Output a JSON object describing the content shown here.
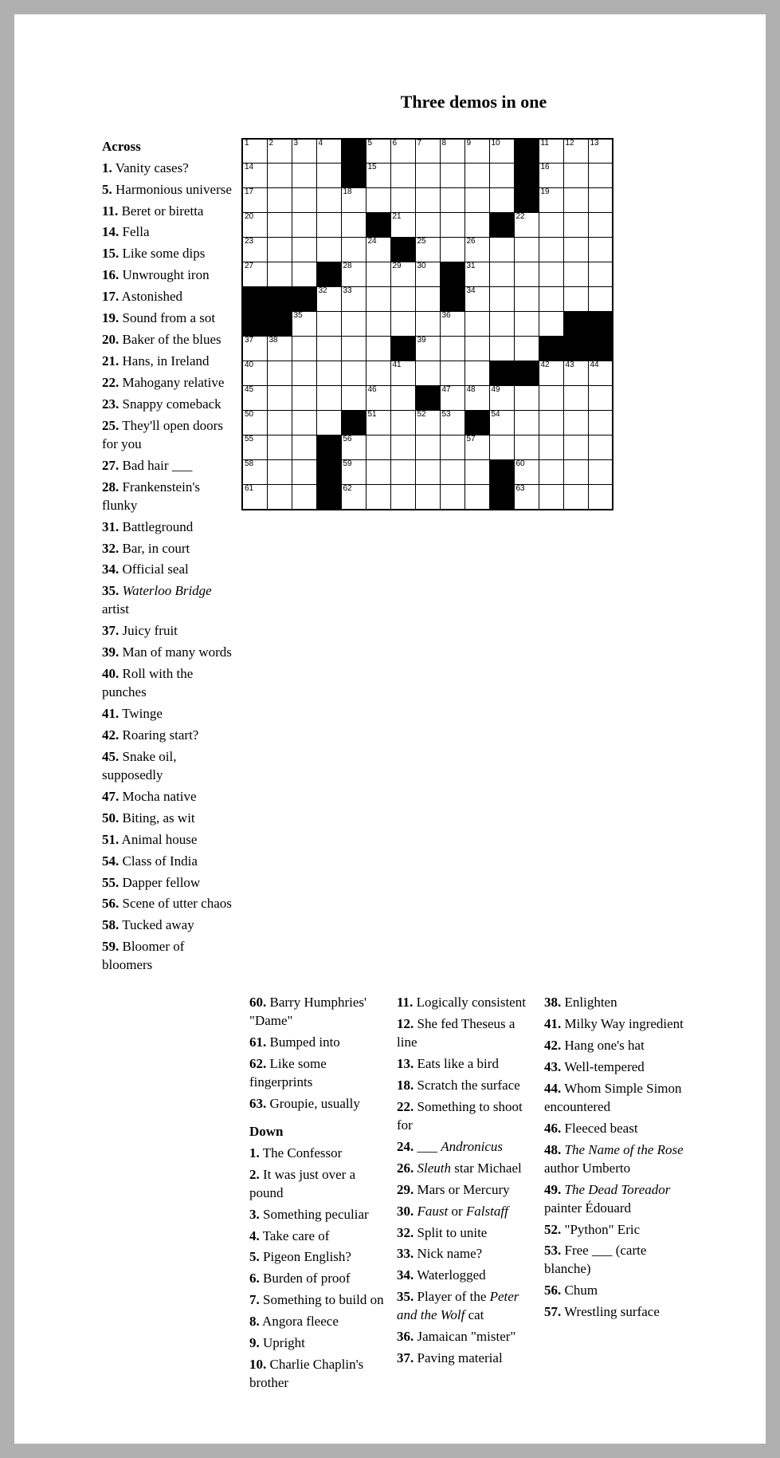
{
  "title": "Three demos in one",
  "grid": {
    "rows": 15,
    "cols": 15,
    "cells": [
      [
        {
          "n": 1
        },
        {
          "n": 2
        },
        {
          "n": 3
        },
        {
          "n": 4
        },
        {
          "b": 1
        },
        {
          "n": 5
        },
        {
          "n": 6
        },
        {
          "n": 7
        },
        {
          "n": 8
        },
        {
          "n": 9
        },
        {
          "n": 10
        },
        {
          "b": 1
        },
        {
          "n": 11
        },
        {
          "n": 12
        },
        {
          "n": 13
        }
      ],
      [
        {
          "n": 14
        },
        {},
        {},
        {},
        {
          "b": 1
        },
        {
          "n": 15
        },
        {},
        {},
        {},
        {},
        {},
        {
          "b": 1
        },
        {
          "n": 16
        },
        {},
        {}
      ],
      [
        {
          "n": 17
        },
        {},
        {},
        {},
        {
          "n": 18
        },
        {},
        {},
        {},
        {},
        {},
        {},
        {
          "b": 1
        },
        {
          "n": 19
        },
        {},
        {}
      ],
      [
        {
          "n": 20
        },
        {},
        {},
        {},
        {},
        {
          "b": 1
        },
        {
          "n": 21
        },
        {},
        {},
        {},
        {
          "b": 1
        },
        {
          "n": 22
        },
        {},
        {},
        {}
      ],
      [
        {
          "n": 23
        },
        {},
        {},
        {},
        {},
        {
          "n": 24
        },
        {
          "b": 1
        },
        {
          "n": 25
        },
        {},
        {
          "n": 26
        },
        {},
        {},
        {},
        {},
        {}
      ],
      [
        {
          "n": 27
        },
        {},
        {},
        {
          "b": 1
        },
        {
          "n": 28
        },
        {},
        {
          "n": 29
        },
        {
          "n": 30
        },
        {
          "b": 1
        },
        {
          "n": 31
        },
        {},
        {},
        {},
        {},
        {}
      ],
      [
        {
          "b": 1
        },
        {
          "b": 1
        },
        {
          "b": 1
        },
        {
          "n": 32
        },
        {
          "n": 33
        },
        {},
        {},
        {},
        {
          "b": 1
        },
        {
          "n": 34
        },
        {},
        {},
        {},
        {},
        {}
      ],
      [
        {
          "b": 1
        },
        {
          "b": 1
        },
        {
          "n": 35
        },
        {},
        {},
        {},
        {},
        {},
        {
          "n": 36
        },
        {},
        {},
        {},
        {},
        {
          "b": 1
        },
        {
          "b": 1
        }
      ],
      [
        {
          "n": 37
        },
        {
          "n": 38
        },
        {},
        {},
        {},
        {},
        {
          "b": 1
        },
        {
          "n": 39
        },
        {},
        {},
        {},
        {},
        {
          "b": 1
        },
        {
          "b": 1
        },
        {
          "b": 1
        }
      ],
      [
        {
          "n": 40
        },
        {},
        {},
        {},
        {},
        {},
        {
          "n": 41
        },
        {},
        {},
        {},
        {
          "b": 1
        },
        {
          "b": 1
        },
        {
          "n": 42
        },
        {
          "n": 43
        },
        {
          "n": 44
        }
      ],
      [
        {
          "n": 45
        },
        {},
        {},
        {},
        {},
        {
          "n": 46
        },
        {},
        {
          "b": 1
        },
        {
          "n": 47
        },
        {
          "n": 48
        },
        {
          "n": 49
        },
        {},
        {},
        {},
        {}
      ],
      [
        {
          "n": 50
        },
        {},
        {},
        {},
        {
          "b": 1
        },
        {
          "n": 51
        },
        {},
        {
          "n": 52
        },
        {
          "n": 53
        },
        {
          "b": 1
        },
        {
          "n": 54
        },
        {},
        {},
        {},
        {}
      ],
      [
        {
          "n": 55
        },
        {},
        {},
        {
          "b": 1
        },
        {
          "n": 56
        },
        {},
        {},
        {},
        {},
        {
          "n": 57
        },
        {},
        {},
        {},
        {},
        {}
      ],
      [
        {
          "n": 58
        },
        {},
        {},
        {
          "b": 1
        },
        {
          "n": 59
        },
        {},
        {},
        {},
        {},
        {},
        {
          "b": 1
        },
        {
          "n": 60
        },
        {},
        {},
        {}
      ],
      [
        {
          "n": 61
        },
        {},
        {},
        {
          "b": 1
        },
        {
          "n": 62
        },
        {},
        {},
        {},
        {},
        {},
        {
          "b": 1
        },
        {
          "n": 63
        },
        {},
        {},
        {}
      ]
    ]
  },
  "headers": {
    "across": "Across",
    "down": "Down"
  },
  "clues": {
    "col_a": [
      {
        "n": "1.",
        "t": "Vanity cases?"
      },
      {
        "n": "5.",
        "t": "Harmonious universe"
      },
      {
        "n": "11.",
        "t": "Beret or biretta"
      },
      {
        "n": "14.",
        "t": "Fella"
      },
      {
        "n": "15.",
        "t": "Like some dips"
      },
      {
        "n": "16.",
        "t": "Unwrought iron"
      },
      {
        "n": "17.",
        "t": "Astonished"
      },
      {
        "n": "19.",
        "t": "Sound from a sot"
      },
      {
        "n": "20.",
        "t": "Baker of the blues"
      },
      {
        "n": "21.",
        "t": "Hans, in Ireland"
      },
      {
        "n": "22.",
        "t": "Mahogany relative"
      },
      {
        "n": "23.",
        "t": "Snappy comeback"
      },
      {
        "n": "25.",
        "t": "They'll open doors for you"
      },
      {
        "n": "27.",
        "t": "Bad hair ___"
      },
      {
        "n": "28.",
        "t": "Frankenstein's flunky"
      },
      {
        "n": "31.",
        "t": "Battleground"
      },
      {
        "n": "32.",
        "t": "Bar, in court"
      },
      {
        "n": "34.",
        "t": "Official seal"
      },
      {
        "n": "35.",
        "t": "<em>Waterloo Bridge</em> artist"
      },
      {
        "n": "37.",
        "t": "Juicy fruit"
      },
      {
        "n": "39.",
        "t": "Man of many words"
      },
      {
        "n": "40.",
        "t": "Roll with the punches"
      },
      {
        "n": "41.",
        "t": "Twinge"
      },
      {
        "n": "42.",
        "t": "Roaring start?"
      },
      {
        "n": "45.",
        "t": "Snake oil, supposedly"
      },
      {
        "n": "47.",
        "t": "Mocha native"
      },
      {
        "n": "50.",
        "t": "Biting, as wit"
      },
      {
        "n": "51.",
        "t": "Animal house"
      },
      {
        "n": "54.",
        "t": "Class of India"
      },
      {
        "n": "55.",
        "t": "Dapper fellow"
      },
      {
        "n": "56.",
        "t": "Scene of utter chaos"
      },
      {
        "n": "58.",
        "t": "Tucked away"
      },
      {
        "n": "59.",
        "t": "Bloomer of bloomers"
      }
    ],
    "col_b": [
      {
        "n": "60.",
        "t": "Barry Humphries' \"Dame\""
      },
      {
        "n": "61.",
        "t": "Bumped into"
      },
      {
        "n": "62.",
        "t": "Like some fingerprints"
      },
      {
        "n": "63.",
        "t": "Groupie, usually"
      }
    ],
    "col_b_down": [
      {
        "n": "1.",
        "t": "The Confessor"
      },
      {
        "n": "2.",
        "t": "It was just over a pound"
      },
      {
        "n": "3.",
        "t": "Something peculiar"
      },
      {
        "n": "4.",
        "t": "Take care of"
      },
      {
        "n": "5.",
        "t": "Pigeon English?"
      },
      {
        "n": "6.",
        "t": "Burden of proof"
      },
      {
        "n": "7.",
        "t": "Something to build on"
      },
      {
        "n": "8.",
        "t": "Angora fleece"
      },
      {
        "n": "9.",
        "t": "Upright"
      },
      {
        "n": "10.",
        "t": "Charlie Chaplin's brother"
      }
    ],
    "col_c": [
      {
        "n": "11.",
        "t": "Logically consistent"
      },
      {
        "n": "12.",
        "t": "She fed Theseus a line"
      },
      {
        "n": "13.",
        "t": "Eats like a bird"
      },
      {
        "n": "18.",
        "t": "Scratch the surface"
      },
      {
        "n": "22.",
        "t": "Something to shoot for"
      },
      {
        "n": "24.",
        "t": "___ <em>Andronicus</em>"
      },
      {
        "n": "26.",
        "t": "<em>Sleuth</em> star Michael"
      },
      {
        "n": "29.",
        "t": "Mars or Mercury"
      },
      {
        "n": "30.",
        "t": "<em>Faust</em> or <em>Falstaff</em>"
      },
      {
        "n": "32.",
        "t": "Split to unite"
      },
      {
        "n": "33.",
        "t": "Nick name?"
      },
      {
        "n": "34.",
        "t": "Waterlogged"
      },
      {
        "n": "35.",
        "t": "Player of the <em>Peter and the Wolf</em> cat"
      },
      {
        "n": "36.",
        "t": "Jamaican \"mister\""
      },
      {
        "n": "37.",
        "t": "Paving material"
      }
    ],
    "col_d": [
      {
        "n": "38.",
        "t": "Enlighten"
      },
      {
        "n": "41.",
        "t": "Milky Way ingredient"
      },
      {
        "n": "42.",
        "t": "Hang one's hat"
      },
      {
        "n": "43.",
        "t": "Well-tempered"
      },
      {
        "n": "44.",
        "t": "Whom Simple Simon encountered"
      },
      {
        "n": "46.",
        "t": "Fleeced beast"
      },
      {
        "n": "48.",
        "t": "<em>The Name of the Rose</em> author Umberto"
      },
      {
        "n": "49.",
        "t": "<em>The Dead Toreador</em> painter Édouard"
      },
      {
        "n": "52.",
        "t": "\"Python\" Eric"
      },
      {
        "n": "53.",
        "t": "Free ___ (carte blanche)"
      },
      {
        "n": "56.",
        "t": "Chum"
      },
      {
        "n": "57.",
        "t": "Wrestling surface"
      }
    ]
  }
}
